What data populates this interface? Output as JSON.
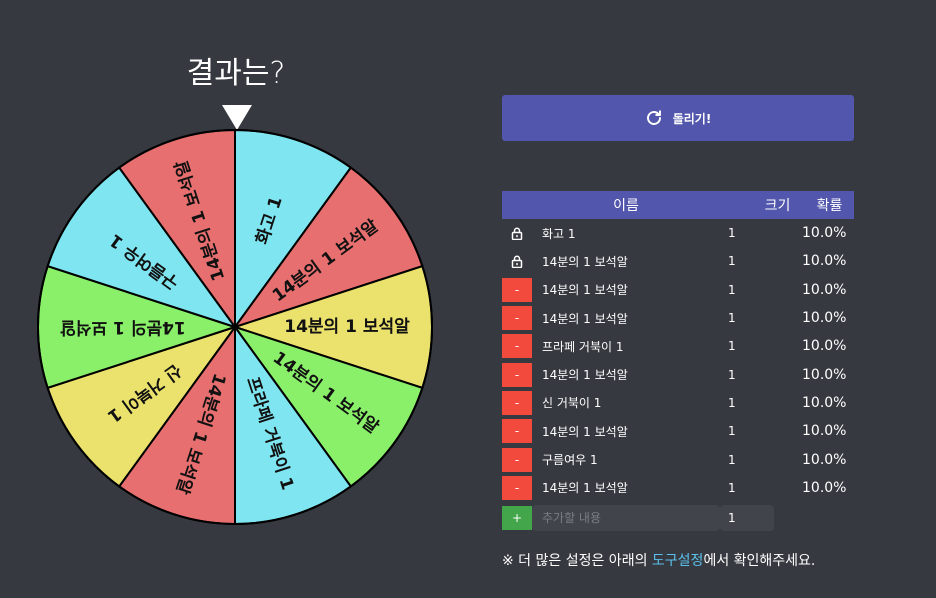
{
  "result_title": "결과는?",
  "spin_button": {
    "label": "돌리기!",
    "icon": "refresh-icon"
  },
  "table": {
    "headers": {
      "name": "이름",
      "size": "크기",
      "prob": "확률"
    },
    "rows": [
      {
        "control": "lock",
        "name": "화고 1",
        "size": "1",
        "prob": "10.0%",
        "color": "#7fe5f0"
      },
      {
        "control": "lock",
        "name": "14분의 1 보석알",
        "size": "1",
        "prob": "10.0%",
        "color": "#e86f6f"
      },
      {
        "control": "minus",
        "control_label": "-",
        "name": "14분의 1 보석알",
        "size": "1",
        "prob": "10.0%",
        "color": "#ebe26d"
      },
      {
        "control": "minus",
        "control_label": "-",
        "name": "14분의 1 보석알",
        "size": "1",
        "prob": "10.0%",
        "color": "#8af06a"
      },
      {
        "control": "minus",
        "control_label": "-",
        "name": "프라페 거북이 1",
        "size": "1",
        "prob": "10.0%",
        "color": "#7fe5f0"
      },
      {
        "control": "minus",
        "control_label": "-",
        "name": "14분의 1 보석알",
        "size": "1",
        "prob": "10.0%",
        "color": "#e86f6f"
      },
      {
        "control": "minus",
        "control_label": "-",
        "name": "신 거북이 1",
        "size": "1",
        "prob": "10.0%",
        "color": "#ebe26d"
      },
      {
        "control": "minus",
        "control_label": "-",
        "name": "14분의 1 보석알",
        "size": "1",
        "prob": "10.0%",
        "color": "#8af06a"
      },
      {
        "control": "minus",
        "control_label": "-",
        "name": "구름여우 1",
        "size": "1",
        "prob": "10.0%",
        "color": "#7fe5f0"
      },
      {
        "control": "minus",
        "control_label": "-",
        "name": "14분의 1 보석알",
        "size": "1",
        "prob": "10.0%",
        "color": "#e86f6f"
      }
    ],
    "add_row": {
      "button_label": "+",
      "name_placeholder": "추가할 내용",
      "size_value": "1"
    }
  },
  "footer": {
    "prefix": "※ 더 많은 설정은 아래의 ",
    "link": "도구설정",
    "suffix": "에서 확인해주세요."
  },
  "colors": {
    "background": "#363940",
    "accent": "#5256ac",
    "minus": "#f24a3d",
    "plus": "#43a64b",
    "link": "#5bc0eb"
  }
}
